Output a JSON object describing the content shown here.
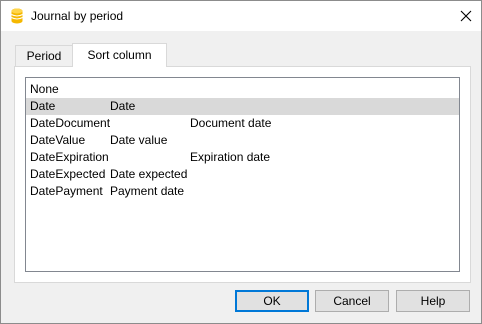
{
  "window": {
    "title": "Journal by period"
  },
  "tabs": [
    {
      "label": "Period",
      "active": false
    },
    {
      "label": "Sort column",
      "active": true
    }
  ],
  "list": {
    "rows": [
      {
        "name": "None",
        "label": "",
        "extra": "",
        "selected": false
      },
      {
        "name": "Date",
        "label": "Date",
        "extra": "",
        "selected": true
      },
      {
        "name": "DateDocument",
        "label": "",
        "extra": "Document date",
        "selected": false
      },
      {
        "name": "DateValue",
        "label": "Date value",
        "extra": "",
        "selected": false
      },
      {
        "name": "DateExpiration",
        "label": "",
        "extra": "Expiration date",
        "selected": false
      },
      {
        "name": "DateExpected",
        "label": "Date expected",
        "extra": "",
        "selected": false
      },
      {
        "name": "DatePayment",
        "label": "Payment date",
        "extra": "",
        "selected": false
      }
    ]
  },
  "buttons": {
    "ok": "OK",
    "cancel": "Cancel",
    "help": "Help"
  },
  "colors": {
    "selection": "#d9d9d9",
    "default_button_border": "#0078d7",
    "app_icon": "#f5b800"
  },
  "icons": {
    "app": "database-icon",
    "close": "close-icon"
  }
}
